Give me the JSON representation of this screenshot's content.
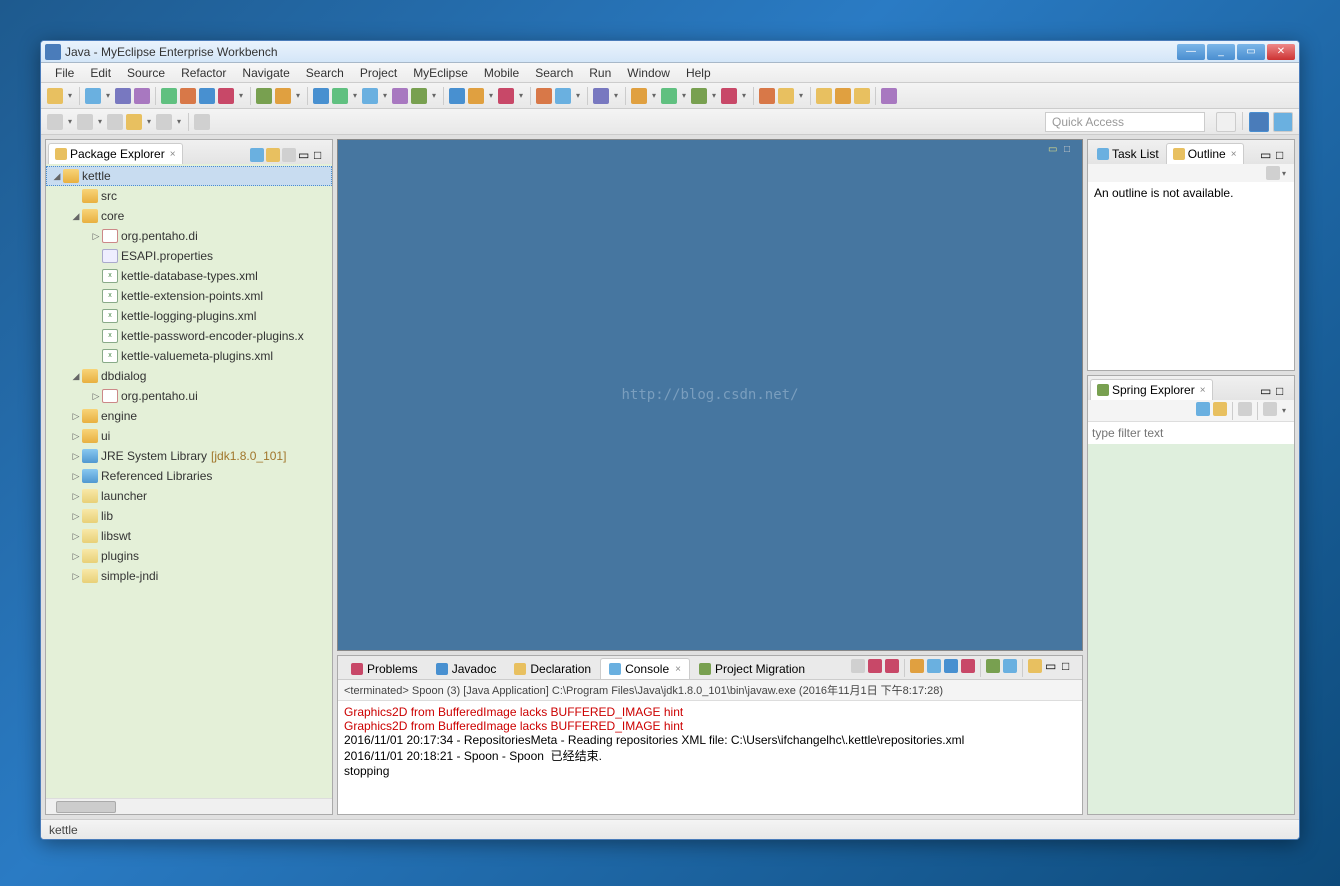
{
  "titlebar": {
    "text": "Java - MyEclipse Enterprise Workbench"
  },
  "menus": [
    "File",
    "Edit",
    "Source",
    "Refactor",
    "Navigate",
    "Search",
    "Project",
    "MyEclipse",
    "Mobile",
    "Search",
    "Run",
    "Window",
    "Help"
  ],
  "quick_access": {
    "placeholder": "Quick Access"
  },
  "package_explorer": {
    "title": "Package Explorer",
    "tree": {
      "project": "kettle",
      "src": "src",
      "core": "core",
      "core_pkg": "org.pentaho.di",
      "esapi": "ESAPI.properties",
      "xml1": "kettle-database-types.xml",
      "xml2": "kettle-extension-points.xml",
      "xml3": "kettle-logging-plugins.xml",
      "xml4": "kettle-password-encoder-plugins.x",
      "xml5": "kettle-valuemeta-plugins.xml",
      "dbdialog": "dbdialog",
      "dbdialog_pkg": "org.pentaho.ui",
      "engine": "engine",
      "ui": "ui",
      "jre": "JRE System Library",
      "jre_suffix": "[jdk1.8.0_101]",
      "reflib": "Referenced Libraries",
      "launcher": "launcher",
      "lib": "lib",
      "libswt": "libswt",
      "plugins": "plugins",
      "simplejndi": "simple-jndi"
    }
  },
  "watermark": "http://blog.csdn.net/",
  "bottom_tabs": {
    "problems": "Problems",
    "javadoc": "Javadoc",
    "declaration": "Declaration",
    "console": "Console",
    "project_migration": "Project Migration"
  },
  "console": {
    "header": "<terminated> Spoon (3) [Java Application] C:\\Program Files\\Java\\jdk1.8.0_101\\bin\\javaw.exe (2016年11月1日 下午8:17:28)",
    "l1": "Graphics2D from BufferedImage lacks BUFFERED_IMAGE hint",
    "l2": "Graphics2D from BufferedImage lacks BUFFERED_IMAGE hint",
    "l3": "2016/11/01 20:17:34 - RepositoriesMeta - Reading repositories XML file: C:\\Users\\ifchangelhc\\.kettle\\repositories.xml",
    "l4": "2016/11/01 20:18:21 - Spoon - Spoon  已经结束.",
    "l5": "stopping"
  },
  "right": {
    "task_list": "Task List",
    "outline": "Outline",
    "outline_msg": "An outline is not available.",
    "spring": "Spring Explorer",
    "spring_filter": "type filter text"
  },
  "statusbar": {
    "text": "kettle"
  },
  "colors": {
    "tb": [
      "#e8c060",
      "#6ab0e0",
      "#7878c0",
      "#a878c0",
      "#60c080",
      "#d87848",
      "#4890d0",
      "#c84868",
      "#78a050",
      "#e0a040"
    ]
  }
}
